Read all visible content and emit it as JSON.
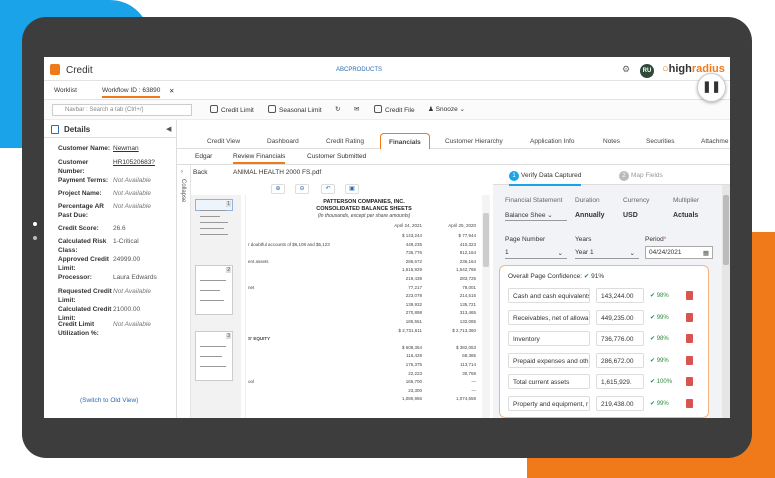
{
  "app": {
    "title": "Credit",
    "brand": "ABCPRODUCTS",
    "avatar": "RU",
    "logo_left": "high",
    "logo_right": "radius"
  },
  "tabs": [
    "Worklist",
    "Workflow ID : 63890"
  ],
  "toolbar": {
    "search_placeholder": "Navbar : Search a tab (Ctrl+/)",
    "buttons": [
      "Credit Limit",
      "Seasonal Limit",
      "Credit File",
      "Snooze"
    ]
  },
  "details": {
    "title": "Details",
    "rows": [
      {
        "k": "Customer Name:",
        "v": "Newman"
      },
      {
        "k": "Customer Number:",
        "v": "HR10520683?"
      },
      {
        "k": "Payment Terms:",
        "v": "Not Available"
      },
      {
        "k": "Project Name:",
        "v": "Not Available"
      },
      {
        "k": "Percentage AR Past Due:",
        "v": "Not Available"
      },
      {
        "k": "Credit Score:",
        "v": "26.6"
      },
      {
        "k": "Calculated Risk Class:",
        "v": "1-Critical"
      },
      {
        "k": "Approved Credit Limit:",
        "v": "24999.00"
      },
      {
        "k": "Processor:",
        "v": "Laura Edwards"
      },
      {
        "k": "Requested Credit Limit:",
        "v": "Not Available"
      },
      {
        "k": "Calculated Credit Limit:",
        "v": "21000.00"
      },
      {
        "k": "Credit Limit Utilization %:",
        "v": "Not Available"
      }
    ],
    "switch": "(Switch to Old View)"
  },
  "main_tabs": [
    "Credit View",
    "Dashboard",
    "Credit Rating",
    "Financials",
    "Customer Hierarchy",
    "Application Info",
    "Notes",
    "Securities",
    "Attachme"
  ],
  "sub_tabs": [
    "Edgar",
    "Review Financials",
    "Customer Submitted"
  ],
  "doc": {
    "back": "Back",
    "filename": "ANIMAL HEALTH 2000 FS.pdf",
    "collapse": "Collapse",
    "thumb_pages": [
      "1",
      "2",
      "3"
    ],
    "company": "PATTERSON COMPANIES, INC.",
    "heading": "CONSOLIDATED BALANCE SHEETS",
    "subheading": "(In thousands, except per share amounts)",
    "col1": "April 24, 2021",
    "col2": "April 25, 2020",
    "rows": [
      {
        "l": "",
        "a": "$    143,244",
        "b": "$     77,944"
      },
      {
        "l": "r doubtful accounts of $6,108 and $5,123",
        "a": "449,235",
        "b": "410,323"
      },
      {
        "l": "",
        "a": "736,776",
        "b": "812,164"
      },
      {
        "l": "ent assets",
        "a": "286,672",
        "b": "236,164"
      },
      {
        "l": "",
        "a": "1,615,929",
        "b": "1,542,765"
      },
      {
        "l": "",
        "a": "219,438",
        "b": "283,725"
      },
      {
        "l": "net",
        "a": "77,217",
        "b": "78,001"
      },
      {
        "l": "",
        "a": "223,078",
        "b": "214,515"
      },
      {
        "l": "",
        "a": "139,932",
        "b": "135,721"
      },
      {
        "l": "",
        "a": "270,898",
        "b": "313,465"
      },
      {
        "l": "",
        "a": "185,551",
        "b": "132,085"
      },
      {
        "l": "",
        "a": "$ 2,731,611",
        "b": "$  2,713,360"
      },
      {
        "l": "S' EQUITY",
        "a": "",
        "b": ""
      },
      {
        "l": "",
        "a": "$    608,354",
        "b": "$    382,053"
      },
      {
        "l": "",
        "a": "116,428",
        "b": "68,385"
      },
      {
        "l": "",
        "a": "175,375",
        "b": "113,714"
      },
      {
        "l": "",
        "a": "22,223",
        "b": "30,768"
      },
      {
        "l": "ool",
        "a": "165,700",
        "b": "—"
      },
      {
        "l": "",
        "a": "23,300",
        "b": "—"
      },
      {
        "l": "",
        "a": "1,080,955",
        "b": "1,074,658"
      }
    ]
  },
  "right": {
    "step1": "Verify Data Captured",
    "step2": "Map Fields",
    "labels": {
      "statement": "Financial Statement",
      "duration": "Duration",
      "currency": "Currency",
      "multiplier": "Multiplier",
      "page": "Page Number",
      "years": "Years",
      "period": "Period"
    },
    "values": {
      "statement": "Balance Shee",
      "duration": "Annually",
      "currency": "USD",
      "multiplier": "Actuals",
      "page": "1",
      "years": "Year 1",
      "period": "04/24/2021"
    },
    "confidence_label": "Overall Page Confidence:",
    "confidence_value": "91%",
    "rows": [
      {
        "label": "Cash and cash equivalents",
        "value": "143,244.00",
        "pct": "98%"
      },
      {
        "label": "Receivables, net of allowa",
        "value": "449,235.00",
        "pct": "99%"
      },
      {
        "label": "Inventory",
        "value": "736,776.00",
        "pct": "98%"
      },
      {
        "label": "Prepaid expenses and oth",
        "value": "286,672.00",
        "pct": "99%"
      },
      {
        "label": "Total current assets",
        "value": "1,615,929.",
        "pct": "100%"
      },
      {
        "label": "Property and equipment, r",
        "value": "219,438.00",
        "pct": "99%"
      }
    ]
  },
  "colors": {
    "accent": "#f07a1a",
    "blue": "#1aa3e8",
    "bezel": "#3d3d3d",
    "green": "#2e8b3a",
    "red": "#d9534f"
  }
}
